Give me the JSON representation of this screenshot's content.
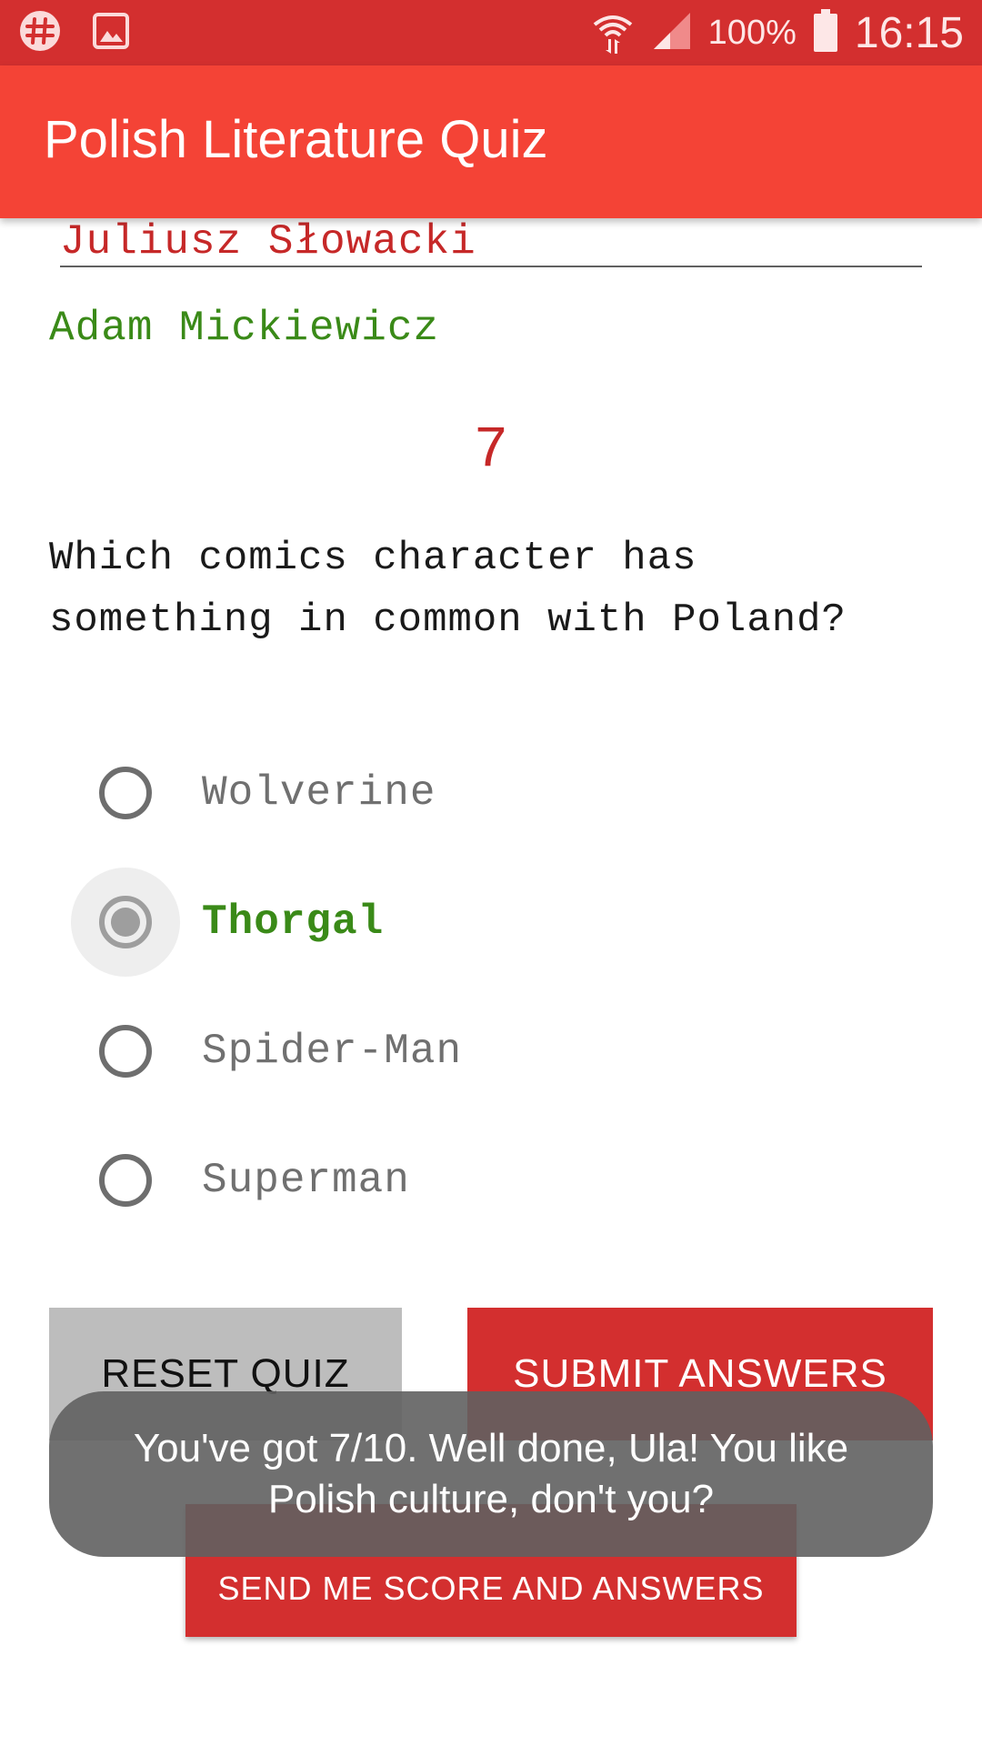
{
  "status_bar": {
    "battery_percent": "100%",
    "time": "16:15",
    "icons": [
      "slack-icon",
      "gallery-icon",
      "wifi-icon",
      "signal-icon",
      "battery-icon"
    ]
  },
  "app_bar": {
    "title": "Polish Literature Quiz"
  },
  "previous_question": {
    "typed_answer": "Juliusz Słowacki",
    "correct_answer": "Adam Mickiewicz"
  },
  "question": {
    "number": "7",
    "text": "Which comics character has something in common with Poland?",
    "options": [
      {
        "label": "Wolverine",
        "selected": false
      },
      {
        "label": "Thorgal",
        "selected": true
      },
      {
        "label": "Spider-Man",
        "selected": false
      },
      {
        "label": "Superman",
        "selected": false
      }
    ]
  },
  "buttons": {
    "reset": "RESET QUIZ",
    "submit": "SUBMIT ANSWERS",
    "send": "SEND ME SCORE AND ANSWERS"
  },
  "toast": {
    "message": "You've got 7/10. Well done, Ula! You like Polish culture, don't you?"
  },
  "colors": {
    "status_bar": "#d32f2f",
    "app_bar": "#f44336",
    "wrong": "#c62828",
    "correct": "#3a8a18",
    "accent_button": "#d32f2f"
  }
}
